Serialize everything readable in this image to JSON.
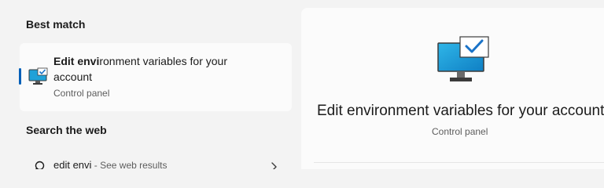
{
  "best_match": {
    "title": "Best match",
    "app_name_highlight": "Edit envi",
    "app_name_rest": "ronment variables for your account",
    "app_type": "Control panel",
    "icon": "monitor-check-icon"
  },
  "search_web": {
    "title": "Search the web",
    "query": "edit envi",
    "hint": " - See web results",
    "icon": "search-icon"
  },
  "preview": {
    "title": "Edit environment variables for your account",
    "subtitle": "Control panel",
    "icon": "monitor-check-icon"
  },
  "colors": {
    "accent": "#005fb8",
    "monitor_screen": "#1fa1d8",
    "check": "#1a73c8"
  }
}
